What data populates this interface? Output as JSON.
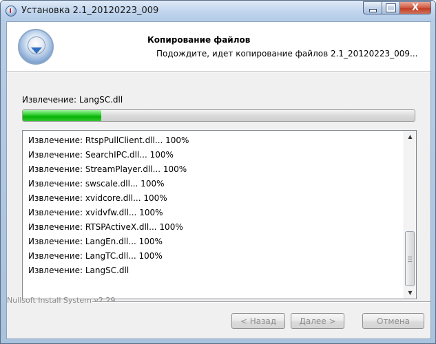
{
  "window": {
    "title": "Установка 2.1_20120223_009",
    "icons": {
      "app": "installer-disc-icon",
      "minimize": "minimize-icon",
      "maximize": "maximize-icon",
      "close": "close-icon"
    },
    "close_glyph": "X"
  },
  "header": {
    "title": "Копирование файлов",
    "subtitle": "Подождите, идет копирование файлов 2.1_20120223_009..."
  },
  "status": {
    "text": "Извлечение: LangSC.dll",
    "progress_fraction": 0.2
  },
  "log": {
    "items": [
      "Извлечение: RtspPullClient.dll... 100%",
      "Извлечение: SearchIPC.dll... 100%",
      "Извлечение: StreamPlayer.dll... 100%",
      "Извлечение: swscale.dll... 100%",
      "Извлечение: xvidcore.dll... 100%",
      "Извлечение: xvidvfw.dll... 100%",
      "Извлечение: RTSPActiveX.dll... 100%",
      "Извлечение: LangEn.dll... 100%",
      "Извлечение: LangTC.dll... 100%",
      "Извлечение: LangSC.dll"
    ],
    "scroll_up_glyph": "▲",
    "scroll_down_glyph": "▼"
  },
  "footer": {
    "brand": "Nullsoft Install System v2.29",
    "buttons": {
      "back": "< Назад",
      "next": "Далее >",
      "cancel": "Отмена"
    }
  },
  "colors": {
    "progress": "#08b208",
    "disabled_text": "#8d8d8d",
    "close_button": "#c13e24"
  }
}
